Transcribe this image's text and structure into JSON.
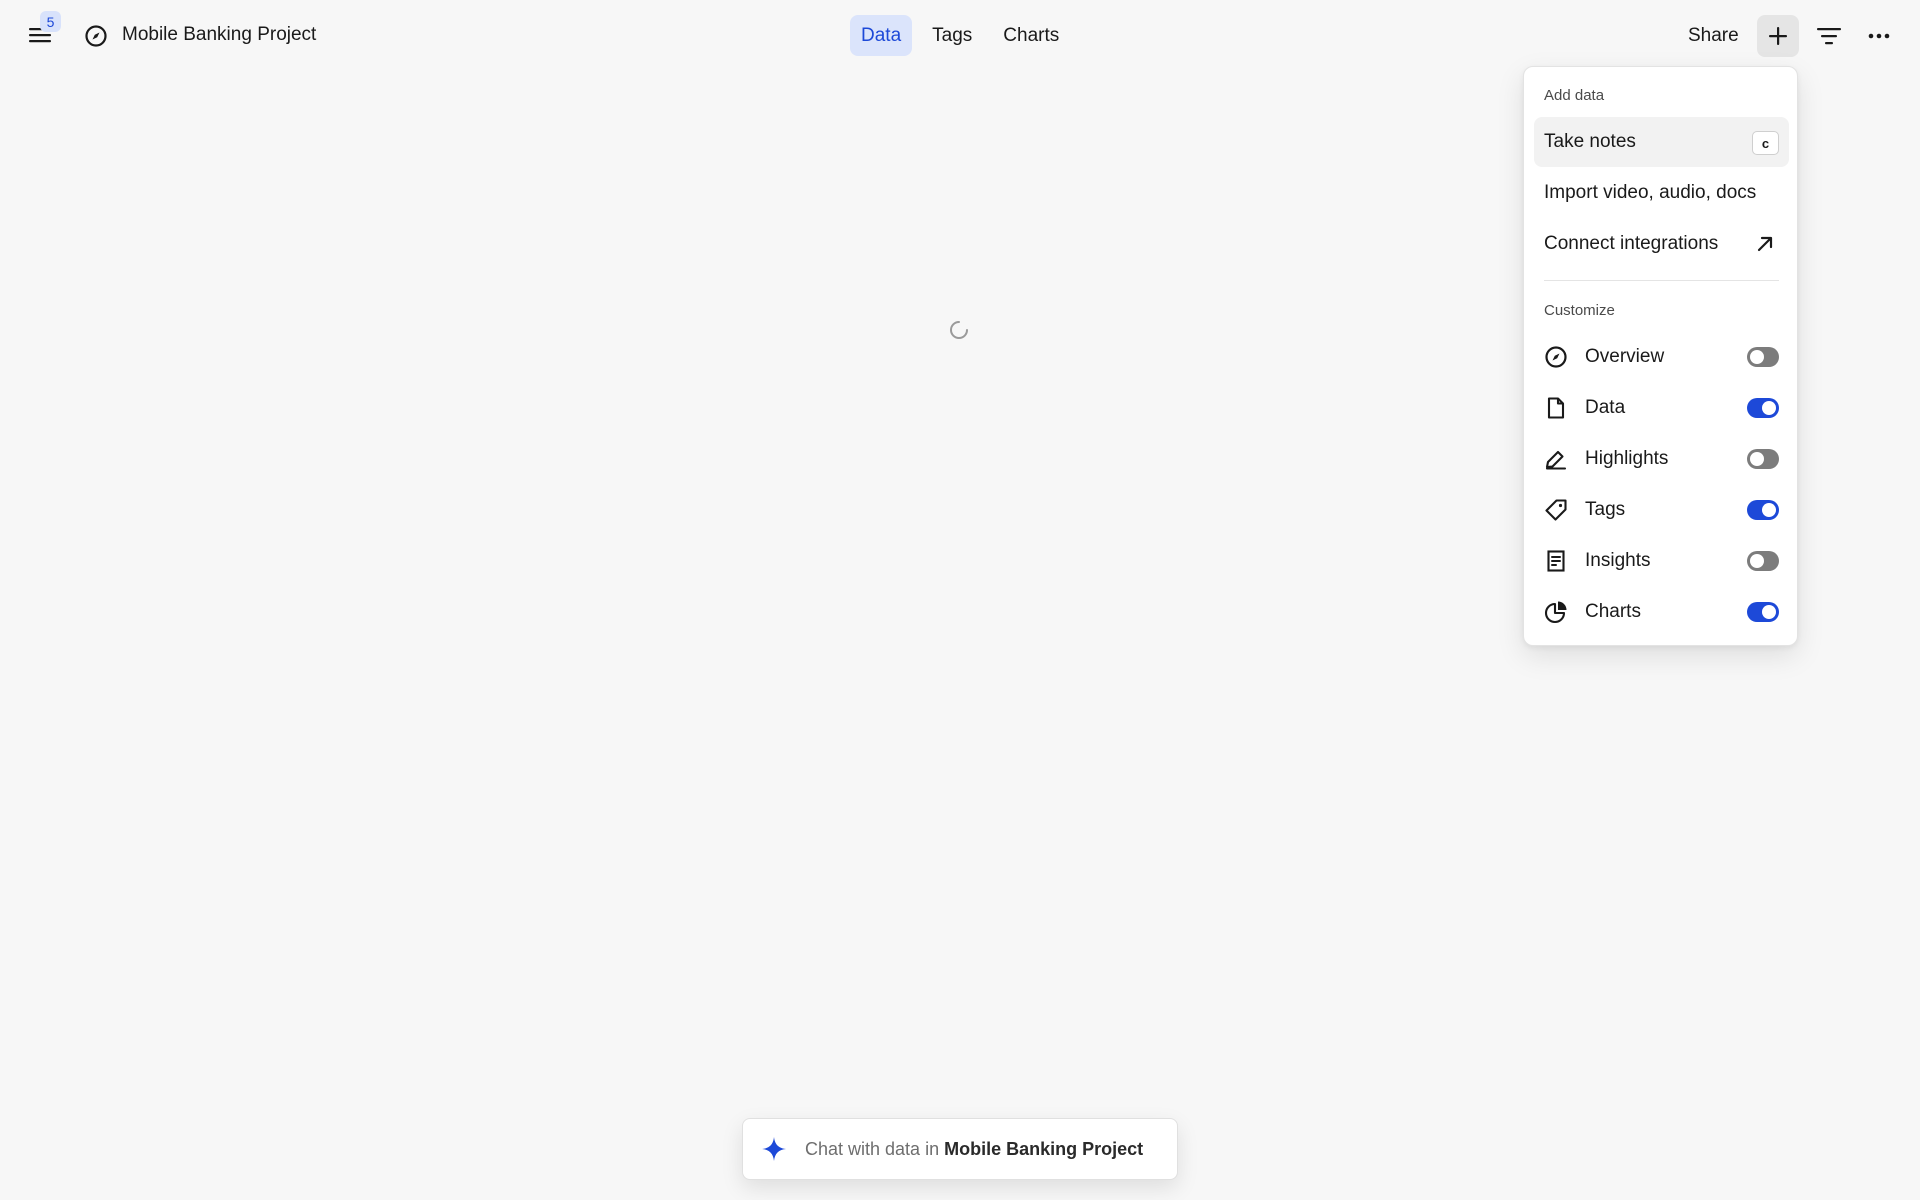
{
  "header": {
    "menu_badge": "5",
    "project_title": "Mobile Banking Project",
    "tabs": [
      {
        "label": "Data",
        "active": true
      },
      {
        "label": "Tags",
        "active": false
      },
      {
        "label": "Charts",
        "active": false
      }
    ],
    "share_label": "Share"
  },
  "dropdown": {
    "add_data_heading": "Add data",
    "add_items": [
      {
        "label": "Take notes",
        "shortcut": "c"
      },
      {
        "label": "Import video, audio, docs"
      },
      {
        "label": "Connect integrations",
        "icon": "arrow-up-right-icon"
      }
    ],
    "customize_heading": "Customize",
    "customize_items": [
      {
        "label": "Overview",
        "icon": "compass-icon",
        "enabled": false
      },
      {
        "label": "Data",
        "icon": "document-icon",
        "enabled": true
      },
      {
        "label": "Highlights",
        "icon": "highlighter-icon",
        "enabled": false
      },
      {
        "label": "Tags",
        "icon": "tag-icon",
        "enabled": true
      },
      {
        "label": "Insights",
        "icon": "insight-doc-icon",
        "enabled": false
      },
      {
        "label": "Charts",
        "icon": "pie-chart-icon",
        "enabled": true
      }
    ]
  },
  "chat": {
    "prefix": "Chat with data in",
    "project": "Mobile Banking Project"
  },
  "colors": {
    "accent": "#1d49d8",
    "accent_light": "#dbe4fb",
    "background": "#f7f7f7",
    "toggle_off": "#7c7c7c"
  }
}
